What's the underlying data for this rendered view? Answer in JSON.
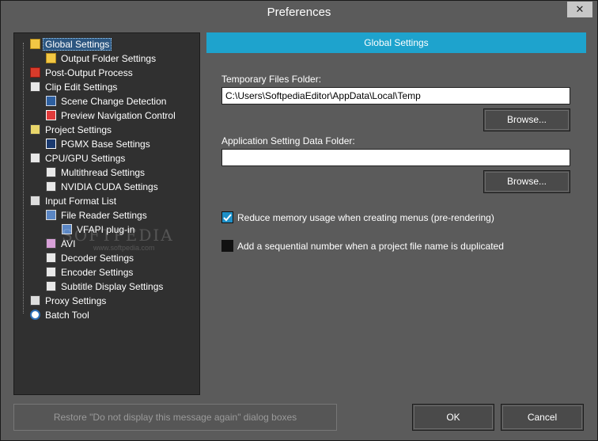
{
  "window": {
    "title": "Preferences",
    "close_label": "✕"
  },
  "tree": {
    "items": [
      {
        "label": "Global Settings",
        "icon": "folder-icon"
      },
      {
        "label": "Output Folder Settings",
        "icon": "folder-icon"
      },
      {
        "label": "Post-Output Process",
        "icon": "process-icon"
      },
      {
        "label": "Clip Edit Settings",
        "icon": "settings-page-icon"
      },
      {
        "label": "Scene Change Detection",
        "icon": "scene-icon"
      },
      {
        "label": "Preview Navigation Control",
        "icon": "navigation-icon"
      },
      {
        "label": "Project Settings",
        "icon": "project-icon"
      },
      {
        "label": "PGMX Base Settings",
        "icon": "pgmx-icon"
      },
      {
        "label": "CPU/GPU Settings",
        "icon": "settings-page-icon"
      },
      {
        "label": "Multithread Settings",
        "icon": "settings-page-icon"
      },
      {
        "label": "NVIDIA CUDA Settings",
        "icon": "settings-page-icon"
      },
      {
        "label": "Input Format List",
        "icon": "list-icon"
      },
      {
        "label": "File Reader Settings",
        "icon": "file-reader-icon"
      },
      {
        "label": "VFAPI plug-in",
        "icon": "plugin-icon"
      },
      {
        "label": "AVI",
        "icon": "avi-icon"
      },
      {
        "label": "Decoder Settings",
        "icon": "settings-page-icon"
      },
      {
        "label": "Encoder Settings",
        "icon": "settings-page-icon"
      },
      {
        "label": "Subtitle Display Settings",
        "icon": "settings-page-icon"
      },
      {
        "label": "Proxy Settings",
        "icon": "proxy-icon"
      },
      {
        "label": "Batch Tool",
        "icon": "clock-icon"
      }
    ]
  },
  "panel": {
    "header": "Global Settings",
    "temp_folder_label": "Temporary Files Folder:",
    "temp_folder_value": "C:\\Users\\SoftpediaEditor\\AppData\\Local\\Temp",
    "browse_label": "Browse...",
    "app_folder_label": "Application Setting Data Folder:",
    "app_folder_value": "",
    "reduce_memory_label": "Reduce memory usage when creating menus (pre-rendering)",
    "reduce_memory_checked": true,
    "sequential_label": "Add a sequential number when a project file name is duplicated",
    "sequential_checked": false
  },
  "footer": {
    "restore_label": "Restore \"Do not display this message again\" dialog boxes",
    "ok_label": "OK",
    "cancel_label": "Cancel"
  },
  "watermark": {
    "text": "SOFTPEDIA",
    "sub": "www.softpedia.com"
  }
}
